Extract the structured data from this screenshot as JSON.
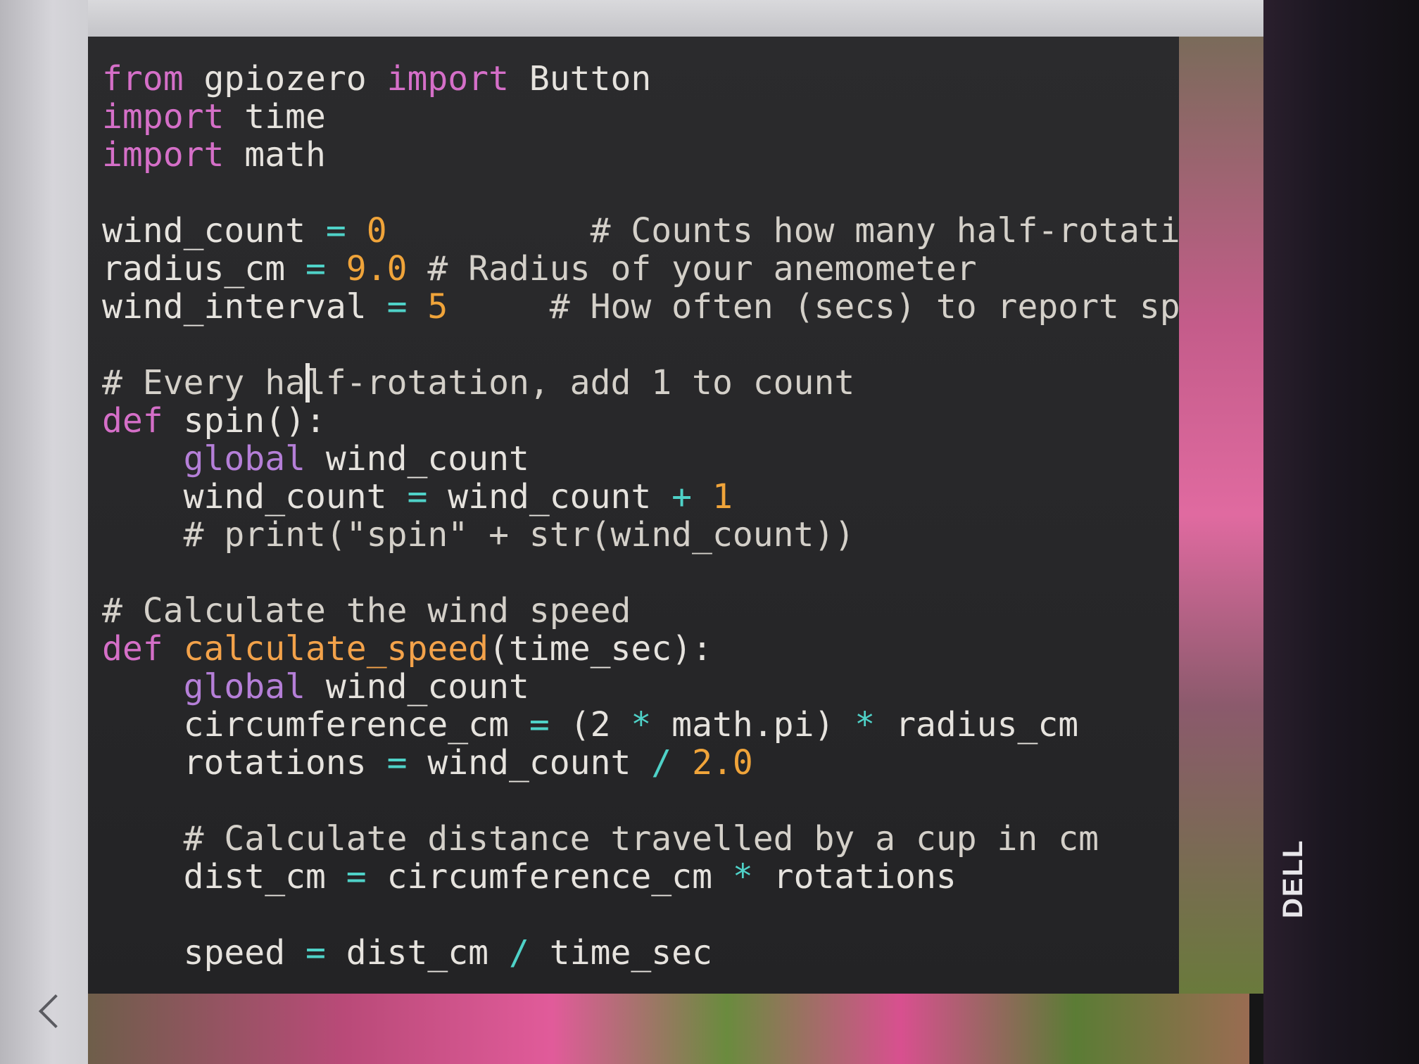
{
  "editor": {
    "lines": [
      {
        "segments": [
          {
            "t": "from",
            "c": "kw"
          },
          {
            "t": " gpiozero ",
            "c": ""
          },
          {
            "t": "import",
            "c": "kw"
          },
          {
            "t": " Button",
            "c": ""
          }
        ]
      },
      {
        "segments": [
          {
            "t": "import",
            "c": "kw"
          },
          {
            "t": " time",
            "c": ""
          }
        ]
      },
      {
        "segments": [
          {
            "t": "import",
            "c": "kw"
          },
          {
            "t": " math",
            "c": ""
          }
        ]
      },
      {
        "segments": []
      },
      {
        "segments": [
          {
            "t": "wind_count ",
            "c": ""
          },
          {
            "t": "=",
            "c": "op"
          },
          {
            "t": " ",
            "c": ""
          },
          {
            "t": "0",
            "c": "num"
          },
          {
            "t": "          # Counts how many half-rotations",
            "c": "cm"
          }
        ]
      },
      {
        "segments": [
          {
            "t": "radius_cm ",
            "c": ""
          },
          {
            "t": "=",
            "c": "op"
          },
          {
            "t": " ",
            "c": ""
          },
          {
            "t": "9.0",
            "c": "num"
          },
          {
            "t": " # Radius of your anemometer",
            "c": "cm"
          }
        ]
      },
      {
        "segments": [
          {
            "t": "wind_interval ",
            "c": ""
          },
          {
            "t": "=",
            "c": "op"
          },
          {
            "t": " ",
            "c": ""
          },
          {
            "t": "5",
            "c": "num"
          },
          {
            "t": "     # How often (secs) to report speed",
            "c": "cm"
          }
        ]
      },
      {
        "segments": []
      },
      {
        "segments": [
          {
            "t": "# Every half-rotation, add 1 to count",
            "c": "cm"
          }
        ]
      },
      {
        "segments": [
          {
            "t": "def",
            "c": "kw"
          },
          {
            "t": " spin():",
            "c": ""
          }
        ]
      },
      {
        "segments": [
          {
            "t": "    ",
            "c": ""
          },
          {
            "t": "global",
            "c": "kwg"
          },
          {
            "t": " wind_count",
            "c": ""
          }
        ]
      },
      {
        "segments": [
          {
            "t": "    wind_count ",
            "c": ""
          },
          {
            "t": "=",
            "c": "op"
          },
          {
            "t": " wind_count ",
            "c": ""
          },
          {
            "t": "+",
            "c": "op"
          },
          {
            "t": " ",
            "c": ""
          },
          {
            "t": "1",
            "c": "num"
          }
        ]
      },
      {
        "segments": [
          {
            "t": "    # print(\"spin\" + str(wind_count))",
            "c": "cm"
          }
        ]
      },
      {
        "segments": []
      },
      {
        "segments": [
          {
            "t": "# Calculate the wind speed",
            "c": "cm"
          }
        ]
      },
      {
        "segments": [
          {
            "t": "def",
            "c": "kw"
          },
          {
            "t": " ",
            "c": ""
          },
          {
            "t": "calculate_speed",
            "c": "fn"
          },
          {
            "t": "(time_sec):",
            "c": ""
          }
        ]
      },
      {
        "segments": [
          {
            "t": "    ",
            "c": ""
          },
          {
            "t": "global",
            "c": "kwg"
          },
          {
            "t": " wind_count",
            "c": ""
          }
        ]
      },
      {
        "segments": [
          {
            "t": "    circumference_cm ",
            "c": ""
          },
          {
            "t": "=",
            "c": "op"
          },
          {
            "t": " (2 ",
            "c": ""
          },
          {
            "t": "*",
            "c": "op"
          },
          {
            "t": " math.pi) ",
            "c": ""
          },
          {
            "t": "*",
            "c": "op"
          },
          {
            "t": " radius_cm",
            "c": ""
          }
        ]
      },
      {
        "segments": [
          {
            "t": "    rotations ",
            "c": ""
          },
          {
            "t": "=",
            "c": "op"
          },
          {
            "t": " wind_count ",
            "c": ""
          },
          {
            "t": "/",
            "c": "op"
          },
          {
            "t": " ",
            "c": ""
          },
          {
            "t": "2.0",
            "c": "num"
          }
        ]
      },
      {
        "segments": []
      },
      {
        "segments": [
          {
            "t": "    # Calculate distance travelled by a cup in cm",
            "c": "cm"
          }
        ]
      },
      {
        "segments": [
          {
            "t": "    dist_cm ",
            "c": ""
          },
          {
            "t": "=",
            "c": "op"
          },
          {
            "t": " circumference_cm ",
            "c": ""
          },
          {
            "t": "*",
            "c": "op"
          },
          {
            "t": " rotations",
            "c": ""
          }
        ]
      },
      {
        "segments": []
      },
      {
        "segments": [
          {
            "t": "    speed ",
            "c": ""
          },
          {
            "t": "=",
            "c": "op"
          },
          {
            "t": " dist_cm ",
            "c": ""
          },
          {
            "t": "/",
            "c": "op"
          },
          {
            "t": " time_sec",
            "c": ""
          }
        ]
      }
    ]
  },
  "monitor": {
    "brand": "DELL"
  }
}
